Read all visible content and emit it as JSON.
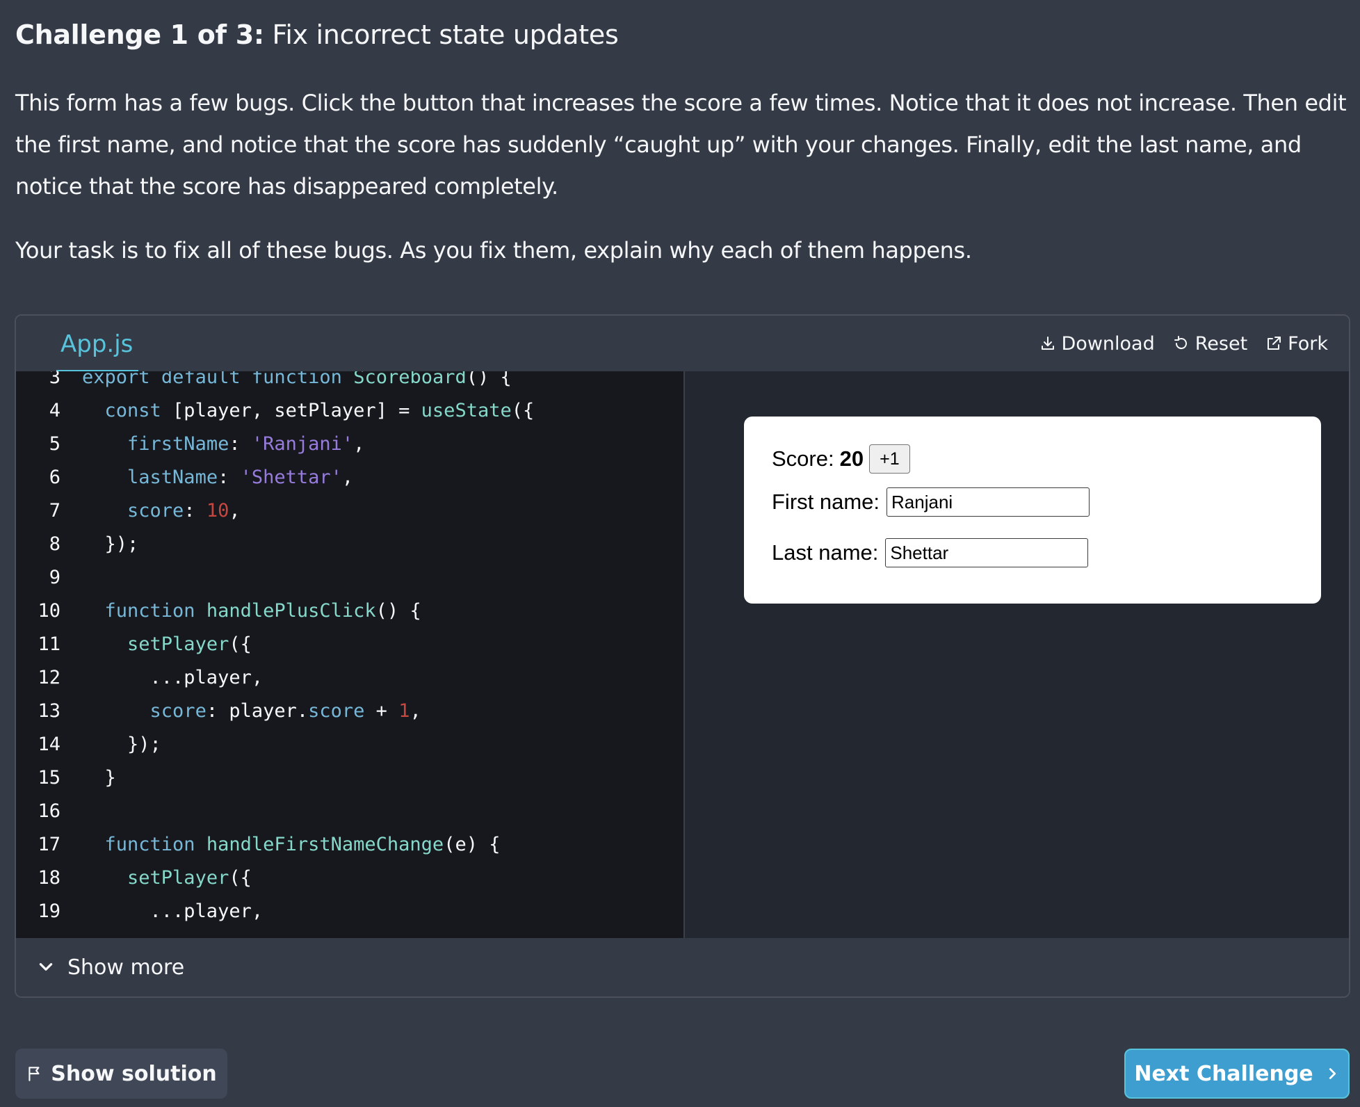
{
  "challenge": {
    "label": "Challenge 1 of 3:",
    "title": "Fix incorrect state updates",
    "description": "This form has a few bugs. Click the button that increases the score a few times. Notice that it does not increase. Then edit the first name, and notice that the score has suddenly “caught up” with your changes. Finally, edit the last name, and notice that the score has disappeared completely.",
    "task": "Your task is to fix all of these bugs. As you fix them, explain why each of them happens."
  },
  "sandbox": {
    "file_tab": "App.js",
    "actions": {
      "download": "Download",
      "reset": "Reset",
      "fork": "Fork"
    },
    "code_lines": [
      {
        "n": "3"
      },
      {
        "n": "4"
      },
      {
        "n": "5"
      },
      {
        "n": "6"
      },
      {
        "n": "7"
      },
      {
        "n": "8"
      },
      {
        "n": "9"
      },
      {
        "n": "10"
      },
      {
        "n": "11"
      },
      {
        "n": "12"
      },
      {
        "n": "13"
      },
      {
        "n": "14"
      },
      {
        "n": "15"
      },
      {
        "n": "16"
      },
      {
        "n": "17"
      },
      {
        "n": "18"
      },
      {
        "n": "19"
      }
    ],
    "show_more": "Show more"
  },
  "preview": {
    "score_label": "Score:",
    "score_value": "20",
    "plus_button": "+1",
    "first_name_label": "First name:",
    "first_name_value": "Ranjani",
    "last_name_label": "Last name:",
    "last_name_value": "Shettar"
  },
  "footer": {
    "show_solution": "Show solution",
    "next_challenge": "Next Challenge"
  },
  "colors": {
    "background": "#343a46",
    "editor": "#16181d",
    "accent": "#58c4dc",
    "next_button": "#3f9ed0"
  }
}
